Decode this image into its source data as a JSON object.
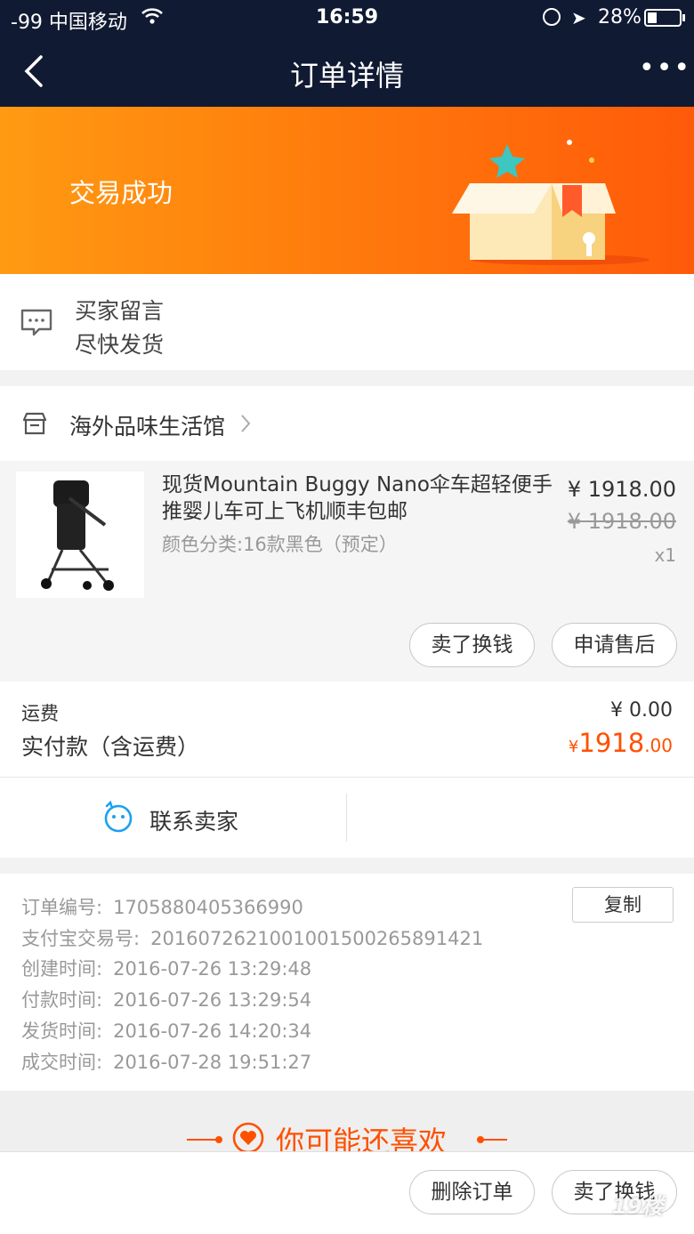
{
  "status_bar": {
    "carrier": "-99 中国移动",
    "time": "16:59",
    "battery_pct": "28%",
    "wifi_icon": "wifi-icon",
    "lock_icon": "rotation-lock-icon",
    "location_icon": "location-arrow-icon"
  },
  "nav": {
    "title": "订单详情",
    "back_icon": "chevron-left-icon",
    "more_icon": "more-dots-icon",
    "more_text": "•••"
  },
  "banner": {
    "state": "交易成功",
    "gradient_start": "#ff9a12",
    "gradient_end": "#ff5a0a"
  },
  "message": {
    "icon": "chat-bubble-icon",
    "label": "买家留言",
    "content": "尽快发货"
  },
  "shop": {
    "icon": "store-icon",
    "name": "海外品味生活馆",
    "chevron_icon": "chevron-right-icon"
  },
  "item": {
    "title": "现货Mountain Buggy Nano伞车超轻便手推婴儿车可上飞机顺丰包邮",
    "sku": "颜色分类:16款黑色（预定）",
    "price": "¥ 1918.00",
    "original_price": "¥ 1918.00",
    "quantity": "x1",
    "buttons": {
      "sell": "卖了换钱",
      "after_sale": "申请售后"
    }
  },
  "totals": {
    "shipping_label": "运费",
    "shipping_value": "¥ 0.00",
    "paid_label": "实付款（含运费）",
    "paid_currency": "¥",
    "paid_integer": "1918",
    "paid_decimal": ".00",
    "accent_color": "#ff5000"
  },
  "contact": {
    "icon": "smiley-chat-icon",
    "label": "联系卖家"
  },
  "order_info": {
    "copy_label": "复制",
    "rows": [
      {
        "label": "订单编号:",
        "value": "1705880405366990"
      },
      {
        "label": "支付宝交易号:",
        "value": "2016072621001001500265891421"
      },
      {
        "label": "创建时间:",
        "value": "2016-07-26 13:29:48"
      },
      {
        "label": "付款时间:",
        "value": "2016-07-26 13:29:54"
      },
      {
        "label": "发货时间:",
        "value": "2016-07-26 14:20:34"
      },
      {
        "label": "成交时间:",
        "value": "2016-07-28 19:51:27"
      }
    ]
  },
  "recommend": {
    "icon": "heart-circle-icon",
    "title": "你可能还喜欢"
  },
  "bottom_bar": {
    "delete": "删除订单",
    "sell": "卖了换钱"
  },
  "watermark": "19楼"
}
